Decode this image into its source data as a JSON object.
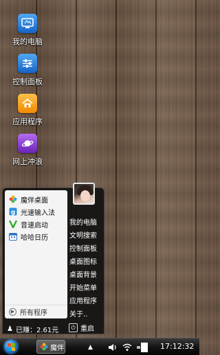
{
  "desktop": {
    "icons": [
      {
        "label": "我的电脑",
        "icon": "monitor-icon"
      },
      {
        "label": "控制面板",
        "icon": "sliders-icon"
      },
      {
        "label": "应用程序",
        "icon": "house-icon"
      },
      {
        "label": "网上冲浪",
        "icon": "planet-icon"
      }
    ]
  },
  "start_menu": {
    "apps": [
      {
        "label": "魔伴桌面",
        "icon": "flower-icon"
      },
      {
        "label": "光速输入法",
        "icon": "keyboard-g-icon"
      },
      {
        "label": "音速启动",
        "icon": "v-logo-icon"
      },
      {
        "label": "哈哈日历",
        "icon": "calendar-icon"
      }
    ],
    "all_programs": "所有程序",
    "right_items": [
      "我的电脑",
      "文明搜索",
      "控制面板",
      "桌面图标",
      "桌面背景",
      "开始菜单",
      "应用程序",
      "关于.."
    ],
    "earned": "已赚：2.61元",
    "restart": "重启"
  },
  "taskbar": {
    "task_button_label": "魔伴",
    "clock": "17:12:32"
  },
  "colors": {
    "accent_blue": "#2a7fcf",
    "menu_background": "#121212",
    "taskbar": "#151515"
  }
}
